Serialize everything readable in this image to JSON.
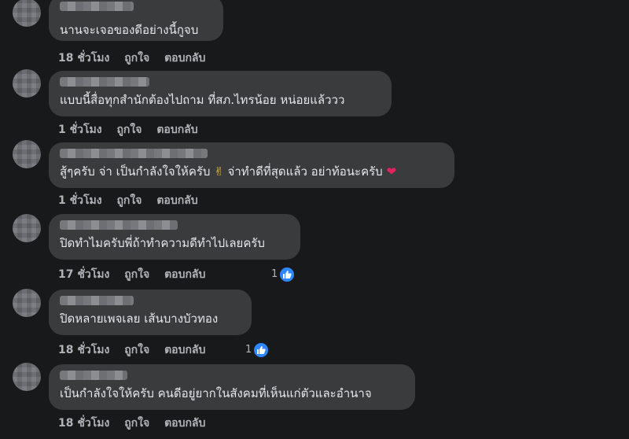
{
  "colors": {
    "background": "#18191a",
    "bubble": "#3a3b3c",
    "text": "#e4e6eb",
    "meta": "#b0b3b8",
    "like_blue": "#2d88ff"
  },
  "comments": [
    {
      "text": "นานจะเจอของดีอย่างนี้กูจบ",
      "time": "18 ชั่วโมง",
      "like": "ถูกใจ",
      "reply": "ตอบกลับ"
    },
    {
      "text": "แบบนี้สื่อทุกสำนักต้องไปถาม ที่สภ.ไทรน้อย หน่อยแล้ววว",
      "time": "1 ชั่วโมง",
      "like": "ถูกใจ",
      "reply": "ตอบกลับ"
    },
    {
      "text_a": "สู้ๆครับ จ่า เป็นกำลังใจให้ครับ ",
      "emoji_a": "✌",
      "text_b": " จ่าทำดีที่สุดแล้ว อย่าท้อนะครับ ",
      "emoji_b": "❤",
      "time": "1 ชั่วโมง",
      "like": "ถูกใจ",
      "reply": "ตอบกลับ"
    },
    {
      "text": "ปิดทำไมครับพี่ถ้าทำความดีทำไปเลยครับ",
      "time": "17 ชั่วโมง",
      "like": "ถูกใจ",
      "reply": "ตอบกลับ",
      "reactions": "1"
    },
    {
      "text": "ปิดหลายเพจเลย เส้นบางบัวทอง",
      "time": "18 ชั่วโมง",
      "like": "ถูกใจ",
      "reply": "ตอบกลับ",
      "reactions": "1"
    },
    {
      "text": "เป็นกำลังใจให้ครับ คนดีอยู่ยากในสังคมที่เห็นแก่ตัวและอำนาจ",
      "time": "18 ชั่วโมง",
      "like": "ถูกใจ",
      "reply": "ตอบกลับ"
    }
  ]
}
